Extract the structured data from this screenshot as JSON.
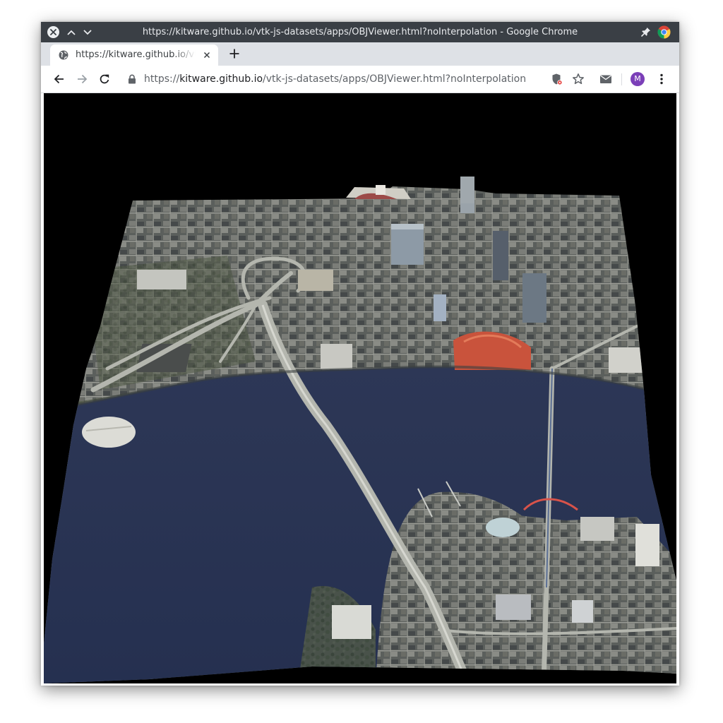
{
  "window": {
    "title": "https://kitware.github.io/vtk-js-datasets/apps/OBJViewer.html?noInterpolation - Google Chrome"
  },
  "tab": {
    "title": "https://kitware.github.io/vtk-js-datasets/apps/OBJViewer.html?noInterpolation"
  },
  "omnibox": {
    "scheme": "https://",
    "host": "kitware.github.io",
    "path": "/vtk-js-datasets/apps/OBJViewer.html?noInterpolation"
  },
  "profile": {
    "initial": "M",
    "color": "#7b3fb8"
  },
  "icons": {
    "window_close": "close-icon",
    "window_up": "chevron-up-icon",
    "window_down": "chevron-down-icon",
    "pin": "pin-icon",
    "browser_logo": "chrome-logo-icon",
    "tab_favicon": "globe-icon",
    "tab_close": "close-icon",
    "new_tab": "plus-icon",
    "back": "arrow-left-icon",
    "forward": "arrow-right-icon",
    "reload": "reload-icon",
    "lock": "lock-icon",
    "extension": "privacy-badger-icon",
    "bookmark": "star-icon",
    "mail": "mail-icon",
    "menu": "kebab-menu-icon"
  },
  "colors": {
    "titlebar": "#3a3f45",
    "tabstrip": "#dee1e6",
    "viewport_background": "#000000",
    "river": "#2b3552",
    "land": "#5e625e",
    "roads": "#b4b6ae"
  }
}
